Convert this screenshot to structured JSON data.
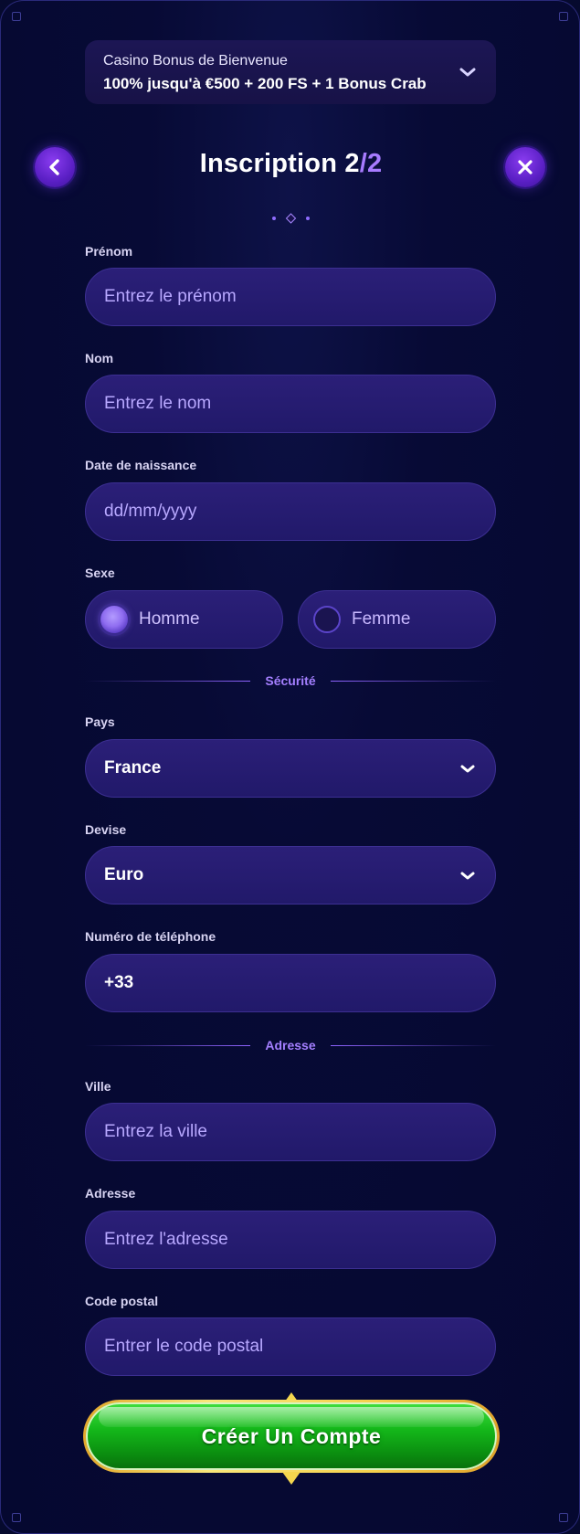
{
  "bonus": {
    "title": "Casino Bonus de Bienvenue",
    "description": "100% jusqu'à €500 + 200 FS + 1 Bonus Crab",
    "icon": "chevron-down-icon"
  },
  "header": {
    "title_main": "Inscription 2",
    "title_accent": "/2",
    "back_icon": "chevron-left-icon",
    "close_icon": "close-icon"
  },
  "form": {
    "first_name": {
      "label": "Prénom",
      "placeholder": "Entrez le prénom"
    },
    "last_name": {
      "label": "Nom",
      "placeholder": "Entrez le nom"
    },
    "birth_date": {
      "label": "Date de naissance",
      "placeholder": "dd/mm/yyyy"
    },
    "gender": {
      "label": "Sexe",
      "options": [
        {
          "label": "Homme",
          "selected": true
        },
        {
          "label": "Femme",
          "selected": false
        }
      ]
    },
    "section_security": "Sécurité",
    "country": {
      "label": "Pays",
      "value": "France"
    },
    "currency": {
      "label": "Devise",
      "value": "Euro"
    },
    "phone": {
      "label": "Numéro de téléphone",
      "value": "+33"
    },
    "section_address": "Adresse",
    "city": {
      "label": "Ville",
      "placeholder": "Entrez la ville"
    },
    "address": {
      "label": "Adresse",
      "placeholder": "Entrez l'adresse"
    },
    "postal_code": {
      "label": "Code postal",
      "placeholder": "Entrer le code postal"
    }
  },
  "submit": {
    "label": "Créer Un Compte"
  },
  "colors": {
    "background": "#060a2e",
    "field": "#24196e",
    "accent": "#a77bff",
    "cta_green": "#14b81a",
    "cta_gold": "#f4d04c"
  }
}
